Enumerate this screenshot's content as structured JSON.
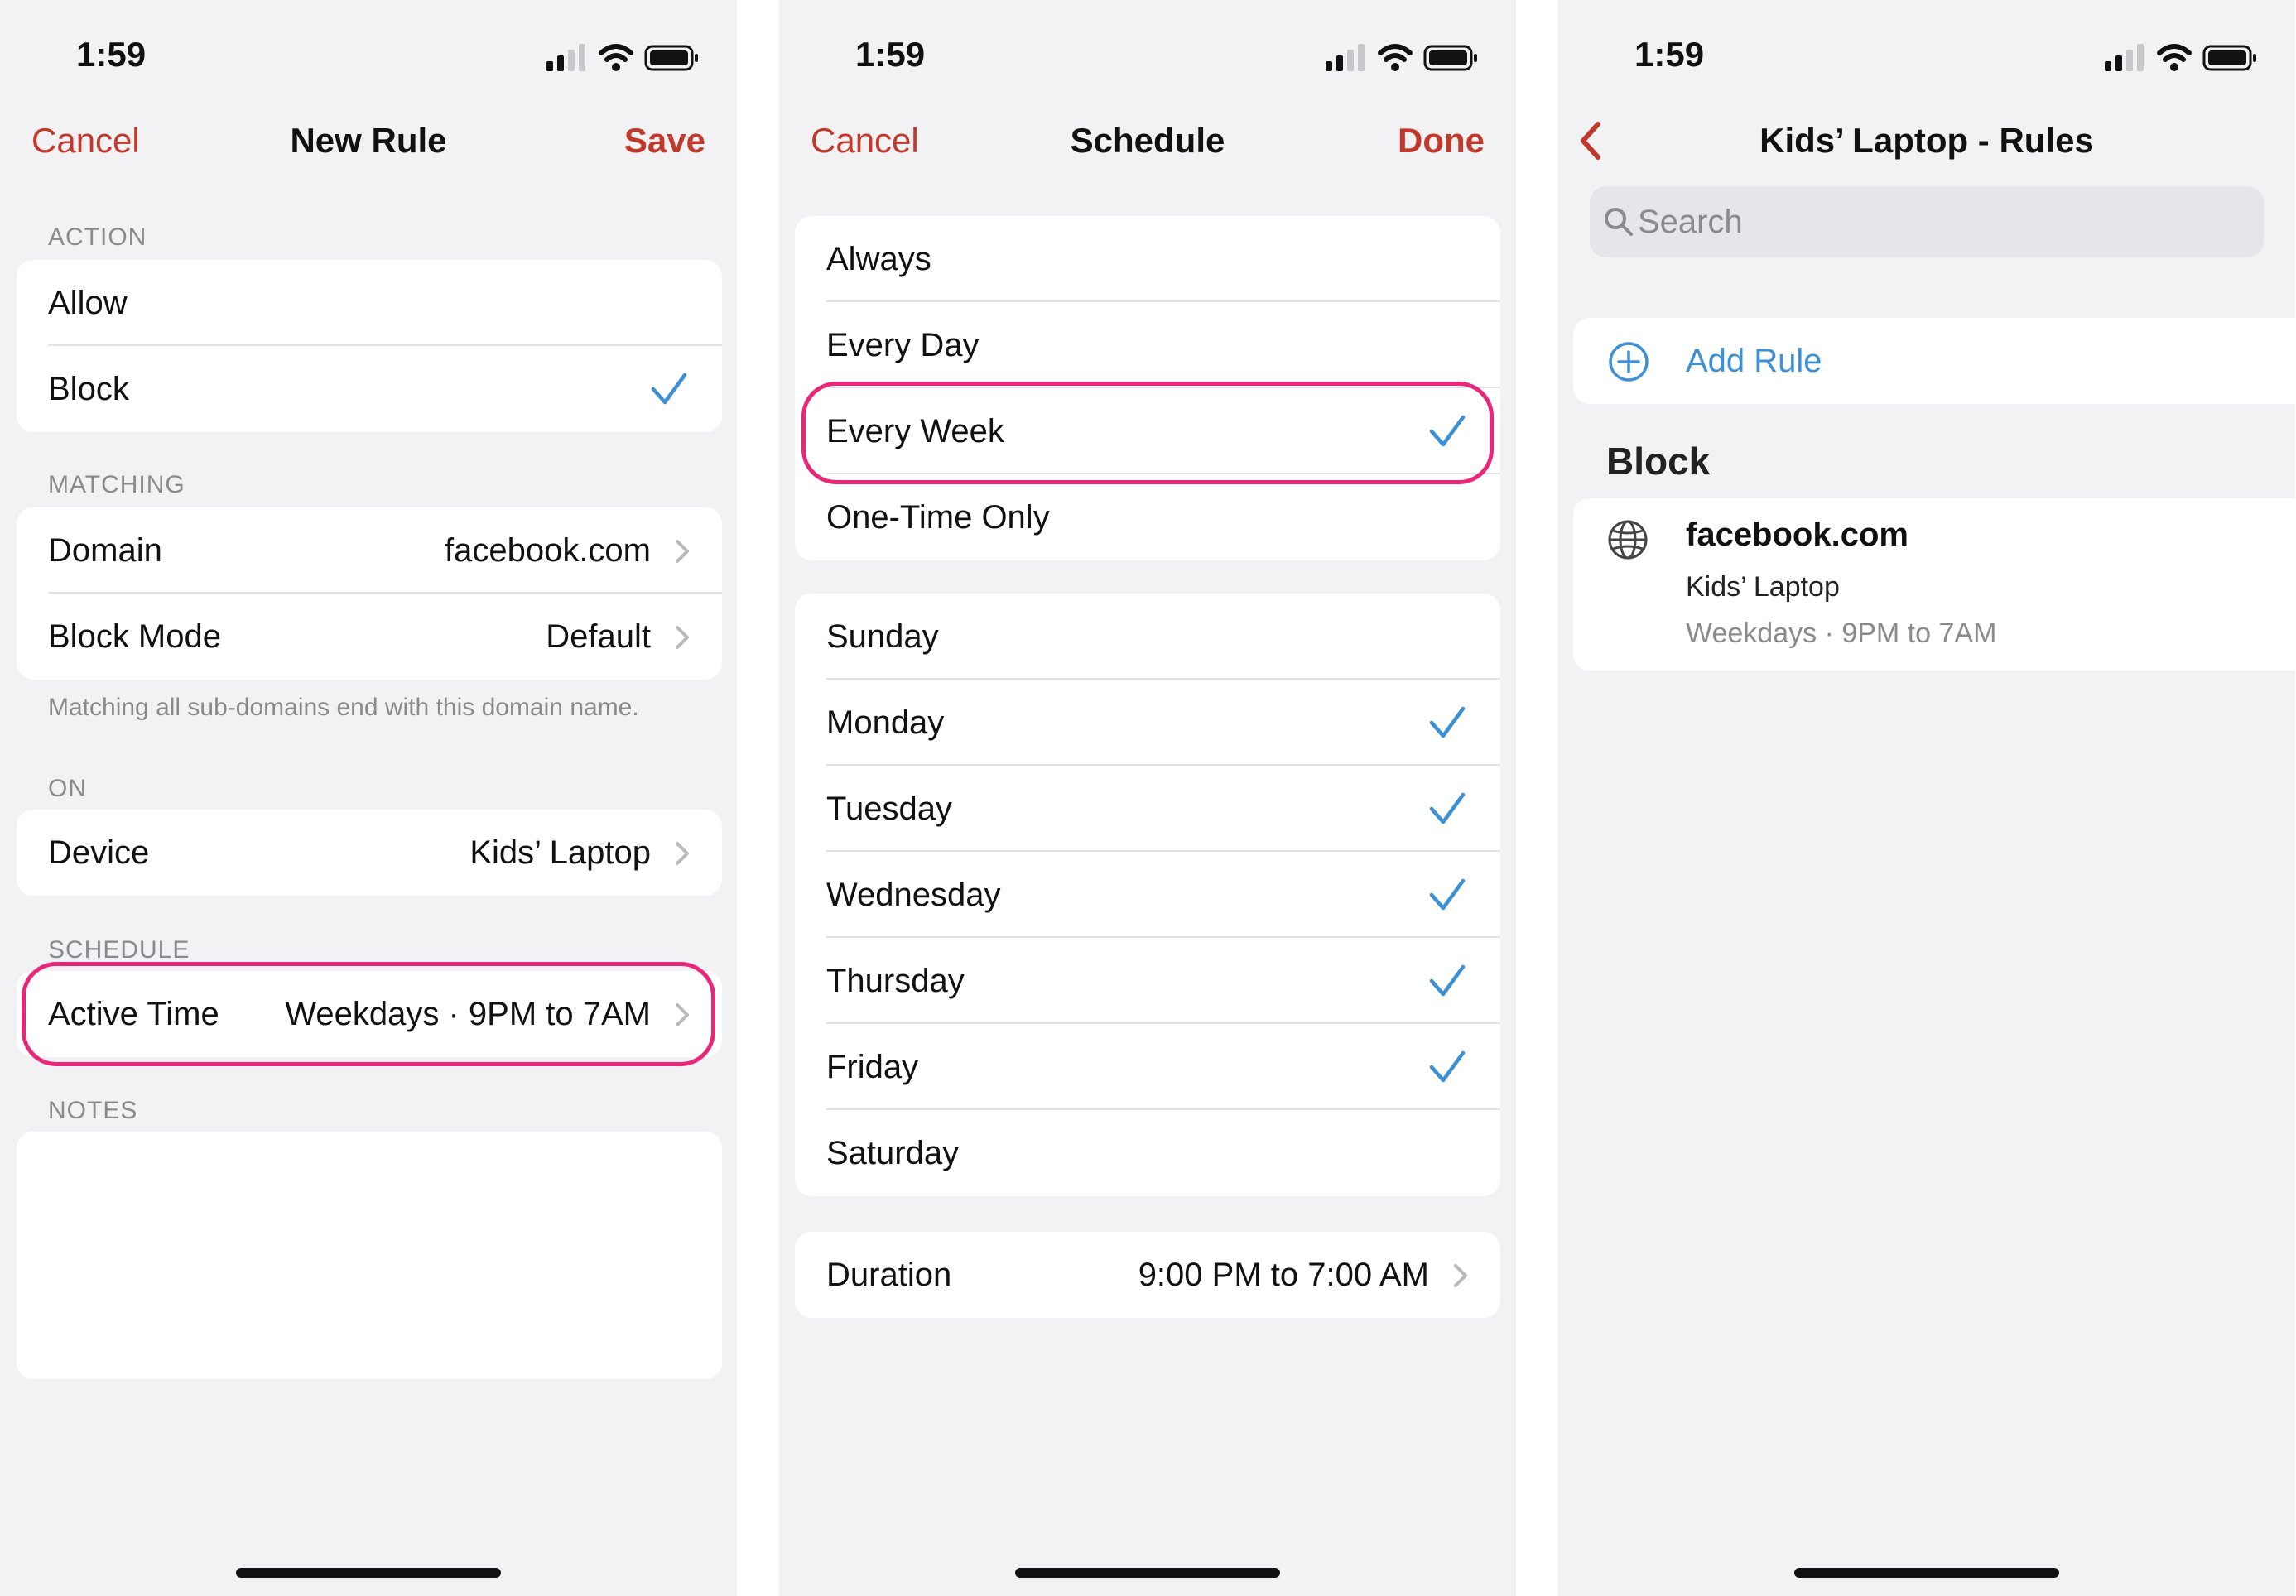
{
  "status": {
    "time": "1:59"
  },
  "colors": {
    "accent": "#c0392b",
    "check": "#3d8fd6",
    "highlight": "#e8267a"
  },
  "new_rule": {
    "cancel": "Cancel",
    "title": "New Rule",
    "save": "Save",
    "action_header": "ACTION",
    "action_rows": [
      {
        "label": "Allow",
        "selected": false
      },
      {
        "label": "Block",
        "selected": true
      }
    ],
    "matching_header": "MATCHING",
    "domain_label": "Domain",
    "domain_value": "facebook.com",
    "block_mode_label": "Block Mode",
    "block_mode_value": "Default",
    "matching_note": "Matching all sub-domains end with this domain name.",
    "on_header": "ON",
    "device_label": "Device",
    "device_value": "Kids’ Laptop",
    "schedule_header": "SCHEDULE",
    "active_time_label": "Active Time",
    "active_time_value": "Weekdays · 9PM to 7AM",
    "notes_header": "NOTES",
    "notes_value": ""
  },
  "schedule": {
    "cancel": "Cancel",
    "title": "Schedule",
    "done": "Done",
    "frequency": [
      {
        "label": "Always",
        "selected": false
      },
      {
        "label": "Every Day",
        "selected": false
      },
      {
        "label": "Every Week",
        "selected": true
      },
      {
        "label": "One-Time Only",
        "selected": false
      }
    ],
    "days": [
      {
        "label": "Sunday",
        "selected": false
      },
      {
        "label": "Monday",
        "selected": true
      },
      {
        "label": "Tuesday",
        "selected": true
      },
      {
        "label": "Wednesday",
        "selected": true
      },
      {
        "label": "Thursday",
        "selected": true
      },
      {
        "label": "Friday",
        "selected": true
      },
      {
        "label": "Saturday",
        "selected": false
      }
    ],
    "duration_label": "Duration",
    "duration_value": "9:00 PM to 7:00 AM"
  },
  "rules": {
    "title": "Kids’ Laptop - Rules",
    "search_placeholder": "Search",
    "add_rule": "Add Rule",
    "block_header": "Block",
    "rule": {
      "domain": "facebook.com",
      "device": "Kids’ Laptop",
      "schedule": "Weekdays · 9PM to 7AM"
    }
  }
}
